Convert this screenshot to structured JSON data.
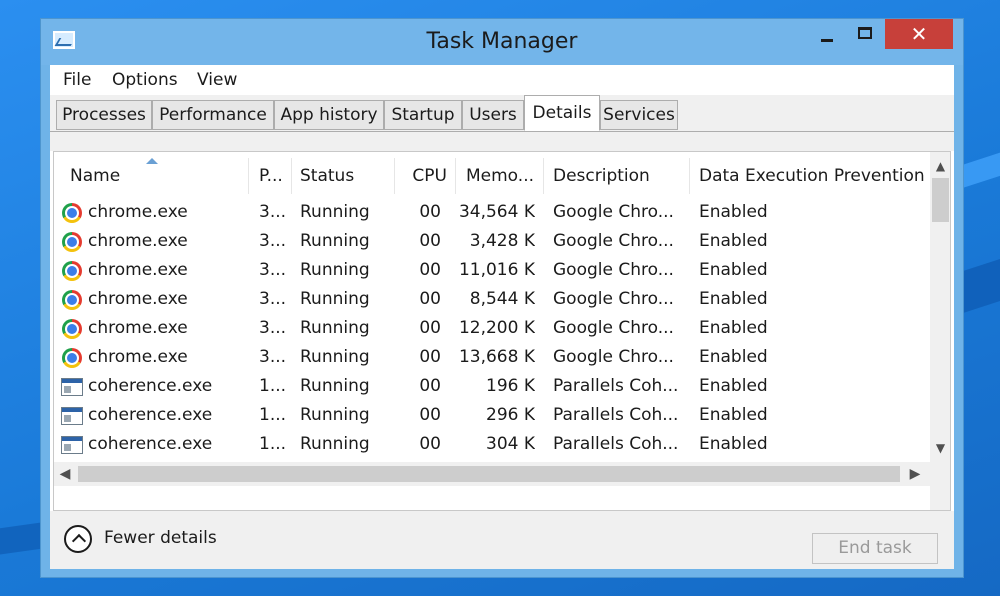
{
  "window": {
    "title": "Task Manager"
  },
  "menu": [
    "File",
    "Options",
    "View"
  ],
  "tabs": [
    {
      "label": "Processes",
      "active": false
    },
    {
      "label": "Performance",
      "active": false
    },
    {
      "label": "App history",
      "active": false
    },
    {
      "label": "Startup",
      "active": false
    },
    {
      "label": "Users",
      "active": false
    },
    {
      "label": "Details",
      "active": true
    },
    {
      "label": "Services",
      "active": false
    }
  ],
  "columns": [
    "Name",
    "P...",
    "Status",
    "CPU",
    "Memo...",
    "Description",
    "Data Execution Prevention"
  ],
  "rows": [
    {
      "icon": "chrome-icon",
      "name": "chrome.exe",
      "pid": "3...",
      "status": "Running",
      "cpu": "00",
      "memory": "34,564 K",
      "description": "Google Chro...",
      "dep": "Enabled"
    },
    {
      "icon": "chrome-icon",
      "name": "chrome.exe",
      "pid": "3...",
      "status": "Running",
      "cpu": "00",
      "memory": "3,428 K",
      "description": "Google Chro...",
      "dep": "Enabled"
    },
    {
      "icon": "chrome-icon",
      "name": "chrome.exe",
      "pid": "3...",
      "status": "Running",
      "cpu": "00",
      "memory": "11,016 K",
      "description": "Google Chro...",
      "dep": "Enabled"
    },
    {
      "icon": "chrome-icon",
      "name": "chrome.exe",
      "pid": "3...",
      "status": "Running",
      "cpu": "00",
      "memory": "8,544 K",
      "description": "Google Chro...",
      "dep": "Enabled"
    },
    {
      "icon": "chrome-icon",
      "name": "chrome.exe",
      "pid": "3...",
      "status": "Running",
      "cpu": "00",
      "memory": "12,200 K",
      "description": "Google Chro...",
      "dep": "Enabled"
    },
    {
      "icon": "chrome-icon",
      "name": "chrome.exe",
      "pid": "3...",
      "status": "Running",
      "cpu": "00",
      "memory": "13,668 K",
      "description": "Google Chro...",
      "dep": "Enabled"
    },
    {
      "icon": "app-window-icon",
      "name": "coherence.exe",
      "pid": "1...",
      "status": "Running",
      "cpu": "00",
      "memory": "196 K",
      "description": "Parallels Coh...",
      "dep": "Enabled"
    },
    {
      "icon": "app-window-icon",
      "name": "coherence.exe",
      "pid": "1...",
      "status": "Running",
      "cpu": "00",
      "memory": "296 K",
      "description": "Parallels Coh...",
      "dep": "Enabled"
    },
    {
      "icon": "app-window-icon",
      "name": "coherence.exe",
      "pid": "1...",
      "status": "Running",
      "cpu": "00",
      "memory": "304 K",
      "description": "Parallels Coh...",
      "dep": "Enabled"
    }
  ],
  "footer": {
    "fewer_details": "Fewer details",
    "end_task": "End task"
  },
  "colors": {
    "titlebar": "#73b5ea",
    "close_button": "#c7403a",
    "desktop": "#1e7fdc"
  }
}
